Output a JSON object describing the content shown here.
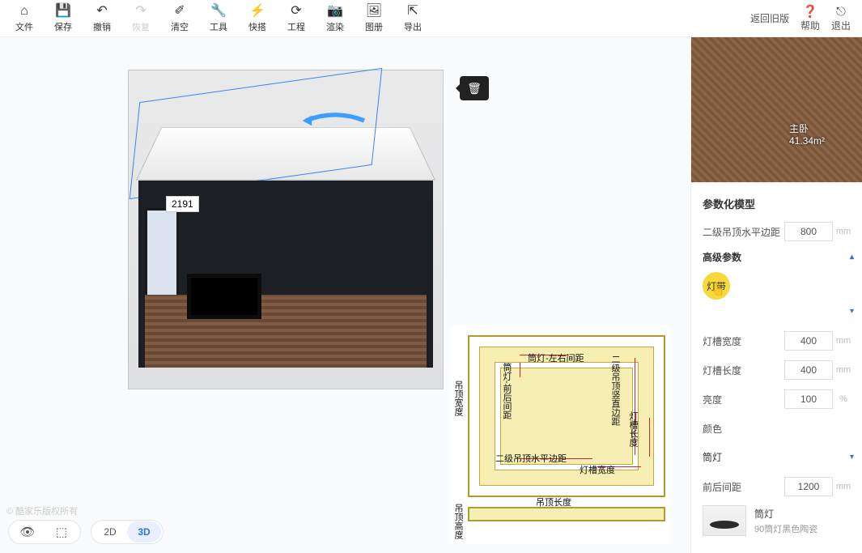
{
  "toolbar": [
    {
      "icon": "⌂",
      "label": "文件",
      "en": "file"
    },
    {
      "icon": "💾",
      "label": "保存",
      "en": "save"
    },
    {
      "icon": "↶",
      "label": "撤销",
      "en": "undo"
    },
    {
      "icon": "↷",
      "label": "恢复",
      "en": "redo",
      "disabled": true
    },
    {
      "icon": "✐",
      "label": "清空",
      "en": "clear"
    },
    {
      "icon": "🔧",
      "label": "工具",
      "en": "tools"
    },
    {
      "icon": "⚡",
      "label": "快搭",
      "en": "quickbuild"
    },
    {
      "icon": "⟳",
      "label": "工程",
      "en": "project"
    },
    {
      "icon": "📷",
      "label": "渲染",
      "en": "render"
    },
    {
      "icon": "🖼",
      "label": "图册",
      "en": "album"
    },
    {
      "icon": "⇱",
      "label": "导出",
      "en": "export"
    }
  ],
  "topright": {
    "back": "返回旧版",
    "help": "帮助",
    "exit": "退出"
  },
  "canvas": {
    "dim": "2191",
    "watermark": "© 酷家乐版权所有"
  },
  "diagram": {
    "l1": "筒灯-左右间距",
    "l2": "筒灯-前后间距",
    "l3": "二级吊顶水平边距",
    "l4": "吊顶宽度",
    "l5": "二级吊顶竖直边距",
    "l6": "灯槽长度",
    "l7": "灯槽宽度",
    "l8": "吊顶长度",
    "l9": "吊顶高度"
  },
  "bottombar": {
    "view2d": "2D",
    "view3d": "3D"
  },
  "minimap": {
    "room": "主卧",
    "area": "41.34m²"
  },
  "panel": {
    "title": "参数化模型",
    "r1": {
      "label": "二级吊顶水平边距",
      "value": "800",
      "unit": "mm"
    },
    "adv": "高级参数",
    "badge": "灯带",
    "r2": {
      "label": "灯槽宽度",
      "value": "400",
      "unit": "mm"
    },
    "r3": {
      "label": "灯槽长度",
      "value": "400",
      "unit": "mm"
    },
    "r4": {
      "label": "亮度",
      "value": "100",
      "unit": "%"
    },
    "r5": {
      "label": "颜色"
    },
    "d1": "筒灯",
    "r6": {
      "label": "前后间距",
      "value": "1200",
      "unit": "mm"
    },
    "thumb": {
      "t1": "筒灯",
      "t2": "90筒灯黑色陶瓷"
    }
  }
}
